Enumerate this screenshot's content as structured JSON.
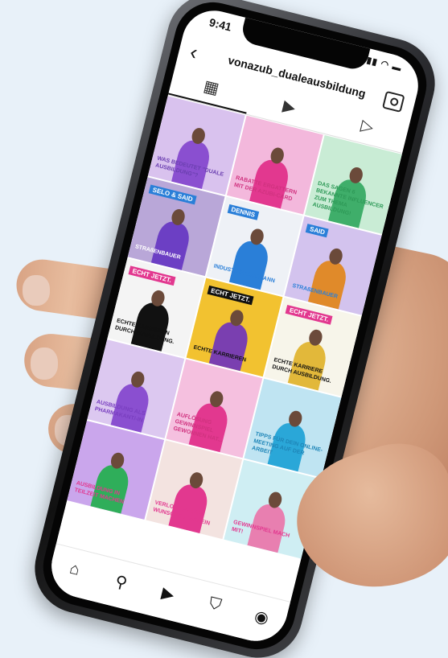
{
  "status_bar": {
    "time": "9:41",
    "icons": "▮▮▮ ◠ ▬"
  },
  "header": {
    "username": "vonazub_dualeausbildung",
    "back_icon": "chevron-left-icon",
    "action_icon": "tagged-icon"
  },
  "tabs": [
    {
      "icon": "grid-icon",
      "glyph": "▦"
    },
    {
      "icon": "reels-icon",
      "glyph": "▶"
    },
    {
      "icon": "play-icon",
      "glyph": "▷"
    }
  ],
  "grid": [
    {
      "bg": "#d9c2ee",
      "accent": "#8a4fd0",
      "caption": "WAS BEDEUTET \"DUALE AUSBILDUNG\"?",
      "capcolor": "#6b3fb0"
    },
    {
      "bg": "#f3b8dc",
      "accent": "#e2388f",
      "caption": "RABATTE ERGATTERN MIT DER AZUBI-CARD",
      "capcolor": "#d0327f"
    },
    {
      "bg": "#c9ecd5",
      "accent": "#3fae6a",
      "caption": "DAS SAGEN 6 BEKANNTE INFLUENCER ZUM THEMA AUSBILDUNG!",
      "capcolor": "#2f9a58"
    },
    {
      "bg": "#b9a7d8",
      "accent": "#6c3fc4",
      "tag": "SELO & SAID",
      "tagbg": "#2a7fd8",
      "caption": "STRAßENBAUER",
      "capcolor": "#fff"
    },
    {
      "bg": "#eef1f6",
      "accent": "#2a7fd8",
      "tag": "DENNIS",
      "tagbg": "#2a7fd8",
      "caption": "INDUSTRIEKAUFMANN",
      "capcolor": "#2a7fd8"
    },
    {
      "bg": "#d3c3ee",
      "accent": "#e08a2a",
      "tag": "SAID",
      "tagbg": "#2a7fd8",
      "caption": "STRAßENBAUER",
      "capcolor": "#2a7fd8"
    },
    {
      "bg": "#f4f4f4",
      "accent": "#111",
      "tag": "ECHT JETZT.",
      "tagbg": "#e2388f",
      "caption": "ECHTE KARRIEREN DURCH AUSBILDUNG.",
      "capcolor": "#111"
    },
    {
      "bg": "#f2c230",
      "accent": "#7a3fb0",
      "tag": "ECHT JETZT.",
      "tagbg": "#111",
      "caption": "ECHTE KARRIEREN",
      "capcolor": "#111"
    },
    {
      "bg": "#f7f5ea",
      "accent": "#e2b83a",
      "tag": "ECHT JETZT.",
      "tagbg": "#e2388f",
      "caption": "ECHTE KARRIERE DURCH AUSBILDUNG.",
      "capcolor": "#111"
    },
    {
      "bg": "#dcc8f0",
      "accent": "#8a4fd0",
      "caption": "AUSBILDUNG ALS PHARMAKANT/-IN",
      "capcolor": "#7a3fc0"
    },
    {
      "bg": "#f5c0df",
      "accent": "#e2388f",
      "caption": "AUFLÖSUNG GEWINNSPIEL GEWONNEN HAT...",
      "capcolor": "#d0327f"
    },
    {
      "bg": "#bfe4f2",
      "accent": "#2aa7d8",
      "caption": "TIPPS FÜR DEIN ONLINE-MEETING AUF DER ARBEIT",
      "capcolor": "#1f86b8"
    },
    {
      "bg": "#caa6ec",
      "accent": "#2fae5a",
      "caption": "AUSBILDUNG IN TEILZEIT MACHEN",
      "capcolor": "#e2388f"
    },
    {
      "bg": "#f3e3e0",
      "accent": "#e2388f",
      "caption": "VERLOSUNG 150€ WUNSCHGUTSCHEIN",
      "capcolor": "#e2388f"
    },
    {
      "bg": "#cfeef3",
      "accent": "#e87fb0",
      "caption": "GEWINNSPIEL MACH MIT!",
      "capcolor": "#e2388f"
    }
  ],
  "bottom_nav": [
    {
      "icon": "home-icon",
      "glyph": "⌂"
    },
    {
      "icon": "search-icon",
      "glyph": "⚲"
    },
    {
      "icon": "reels-icon",
      "glyph": "▶"
    },
    {
      "icon": "shop-icon",
      "glyph": "⛉"
    },
    {
      "icon": "profile-icon",
      "glyph": "◉"
    }
  ]
}
